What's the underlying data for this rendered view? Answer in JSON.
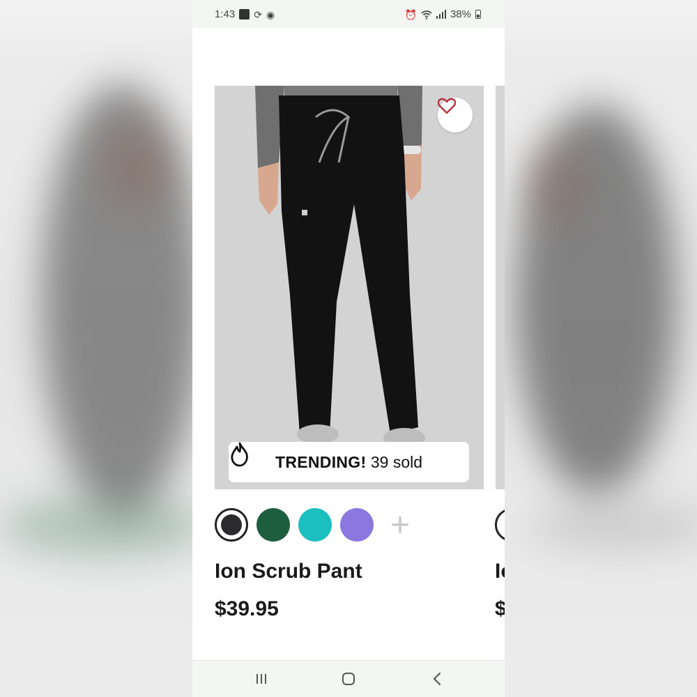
{
  "status_bar": {
    "time": "1:43",
    "battery": "38%",
    "icons": [
      "app-icon",
      "sync-icon",
      "record-icon",
      "alarm-icon",
      "wifi-icon",
      "signal-icon",
      "battery-icon"
    ]
  },
  "product": {
    "name": "Ion Scrub Pant",
    "price": "$39.95",
    "favorite_icon": "heart-icon",
    "badge": {
      "icon": "flame-icon",
      "strong": "TRENDING!",
      "text": " 39 sold"
    },
    "swatches": [
      {
        "name": "black",
        "color": "#2b2b2e",
        "selected": true
      },
      {
        "name": "green",
        "color": "#1f5d3f",
        "selected": false
      },
      {
        "name": "teal",
        "color": "#1cbfbf",
        "selected": false
      },
      {
        "name": "lavender",
        "color": "#8a78e0",
        "selected": false
      }
    ],
    "more_colors": "+"
  },
  "next_product": {
    "name_partial": "Io",
    "price_partial": "$"
  },
  "nav_bar": {
    "items": [
      "recents-icon",
      "home-icon",
      "back-icon"
    ]
  },
  "colors": {
    "heart": "#b3303a",
    "text": "#1a1a1a",
    "photo_bg": "#d4d4d4"
  }
}
